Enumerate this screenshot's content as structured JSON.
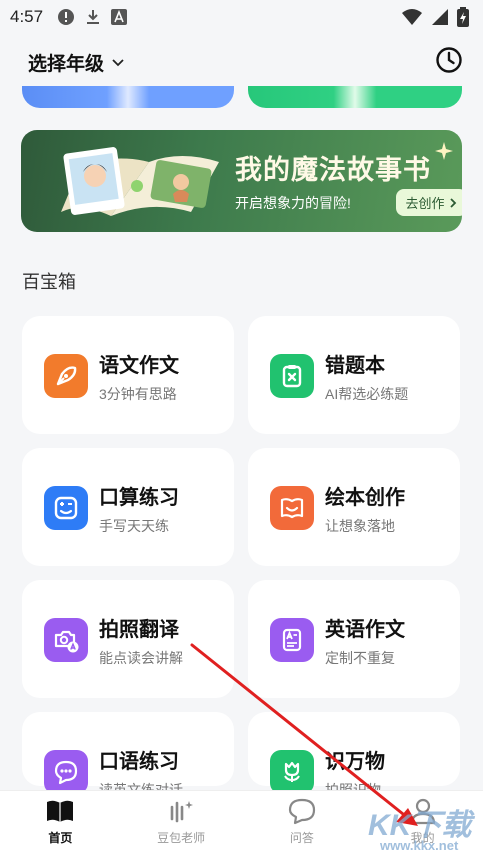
{
  "status_bar": {
    "time": "4:57"
  },
  "header": {
    "grade_select_label": "选择年级"
  },
  "banner": {
    "title": "我的魔法故事书",
    "subtitle": "开启想象力的冒险!",
    "button_label": "去创作"
  },
  "toolbox": {
    "title": "百宝箱",
    "items": [
      {
        "name": "语文作文",
        "desc": "3分钟有思路",
        "icon": "pen-nib-icon",
        "color": "#f27b2c"
      },
      {
        "name": "错题本",
        "desc": "AI帮选必练题",
        "icon": "clipboard-x-icon",
        "color": "#21c26f"
      },
      {
        "name": "口算练习",
        "desc": "手写天天练",
        "icon": "calc-face-icon",
        "color": "#2e7cf6"
      },
      {
        "name": "绘本创作",
        "desc": "让想象落地",
        "icon": "picture-book-icon",
        "color": "#f26a3a"
      },
      {
        "name": "拍照翻译",
        "desc": "能点读会讲解",
        "icon": "camera-translate-icon",
        "color": "#9a5cf0"
      },
      {
        "name": "英语作文",
        "desc": "定制不重复",
        "icon": "english-doc-icon",
        "color": "#9a5cf0"
      },
      {
        "name": "口语练习",
        "desc": "读英文练对话",
        "icon": "chat-bubble-icon",
        "color": "#9a5cf0"
      },
      {
        "name": "识万物",
        "desc": "拍照识物",
        "icon": "tulip-icon",
        "color": "#21c26f"
      }
    ]
  },
  "tab_bar": {
    "tabs": [
      {
        "label": "首页",
        "active": true
      },
      {
        "label": "豆包老师",
        "active": false
      },
      {
        "label": "问答",
        "active": false
      },
      {
        "label": "我的",
        "active": false
      }
    ]
  },
  "watermark": {
    "text": "KK下载",
    "url": "www.kkx.net"
  }
}
